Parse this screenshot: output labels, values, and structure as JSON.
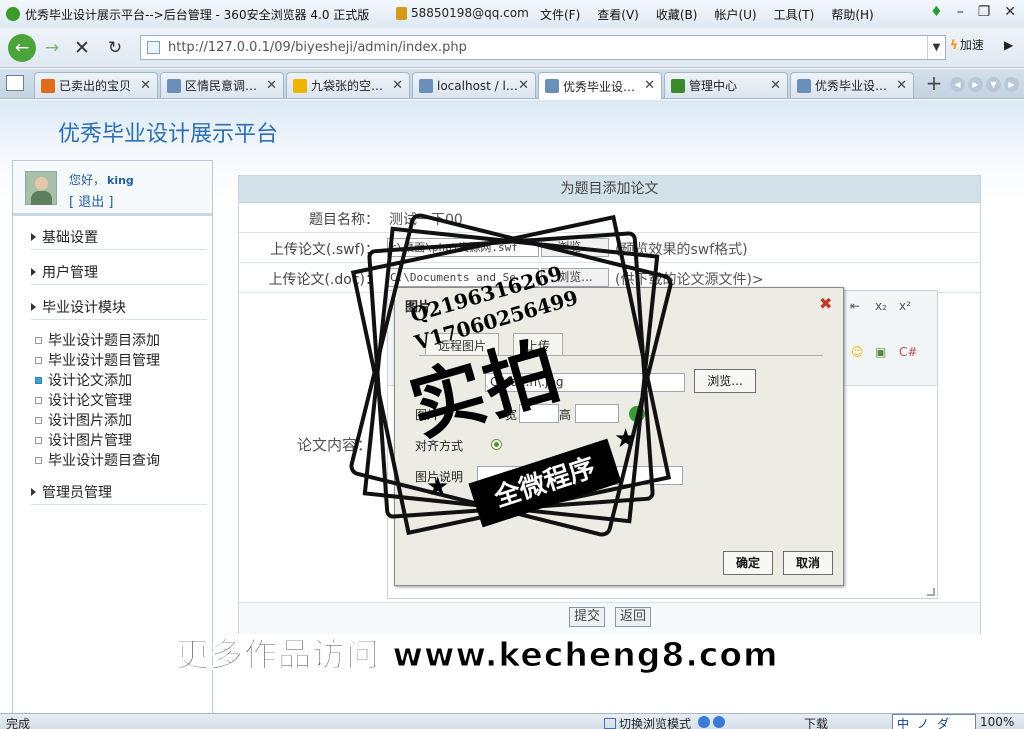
{
  "window": {
    "title": "优秀毕业设计展示平台-->后台管理 - 360安全浏览器 4.0 正式版",
    "account": "58850198@qq.com",
    "menus": [
      "文件(F)",
      "查看(V)",
      "收藏(B)",
      "帐户(U)",
      "工具(T)",
      "帮助(H)"
    ]
  },
  "address_bar": {
    "url": "http://127.0.0.1/09/biyesheji/admin/index.php",
    "speed_label": "加速"
  },
  "tabs": [
    {
      "label": "已卖出的宝贝",
      "icon_color": "#e06c1a",
      "active": false
    },
    {
      "label": "区情民意调…",
      "icon_color": "#6a8fb8",
      "active": false
    },
    {
      "label": "九袋张的空…",
      "icon_color": "#f0b400",
      "active": false
    },
    {
      "label": "localhost / l…",
      "icon_color": "#6a8fb8",
      "active": false
    },
    {
      "label": "优秀毕业设…",
      "icon_color": "#6a8fb8",
      "active": true
    },
    {
      "label": "管理中心",
      "icon_color": "#3a8a2a",
      "active": false
    },
    {
      "label": "优秀毕业设…",
      "icon_color": "#6a8fb8",
      "active": false
    }
  ],
  "site": {
    "title": "优秀毕业设计展示平台"
  },
  "user": {
    "greeting": "您好，",
    "name": "king",
    "logout": "[ 退出 ]"
  },
  "sidebar": {
    "sections": [
      "基础设置",
      "用户管理",
      "毕业设计模块",
      "管理员管理"
    ],
    "sub_items": [
      {
        "label": "毕业设计题目添加",
        "active": false
      },
      {
        "label": "毕业设计题目管理",
        "active": false
      },
      {
        "label": "设计论文添加",
        "active": true
      },
      {
        "label": "设计论文管理",
        "active": false
      },
      {
        "label": "设计图片添加",
        "active": false
      },
      {
        "label": "设计图片管理",
        "active": false
      },
      {
        "label": "毕业设计题目查询",
        "active": false
      }
    ]
  },
  "form": {
    "title": "为题目添加论文",
    "topic_label": "题目名称：",
    "topic_value": "测试一下00",
    "swf_label": "上传论文(.swf)：",
    "swf_value": "r\\桌面\\php\\资源网.swf",
    "swf_browse": "浏览...",
    "swf_hint": "(预览效果的swf格式)",
    "doc_label": "上传论文(.doc)：",
    "doc_value": "C:\\Documents and Se",
    "doc_browse": "浏览...",
    "doc_hint": "(供下载的论文源文件)>",
    "content_label": "论文内容：",
    "submit": "提交",
    "back": "返回"
  },
  "dialog": {
    "title": "图片",
    "tab_remote": "远程图片",
    "tab_upload": "上传",
    "file_value": "C:\\fa...n\\.jpg",
    "browse": "浏览...",
    "size_label": "图片",
    "width_label": "宽",
    "height_label": "高",
    "align_label": "对齐方式",
    "desc_label": "图片说明",
    "ok": "确定",
    "cancel": "取消"
  },
  "watermark": {
    "qq1": "Q2196316269",
    "qq2": "V17060256499",
    "big": "实拍",
    "ribbon": "全微程序",
    "bottom": "更多作品访问 www.kecheng8.com"
  },
  "status": {
    "text": "完成",
    "switch_label": "切换浏览模式",
    "download_label": "下载",
    "ime": [
      "中",
      "ノ",
      "ダ"
    ],
    "zoom": "100%"
  }
}
